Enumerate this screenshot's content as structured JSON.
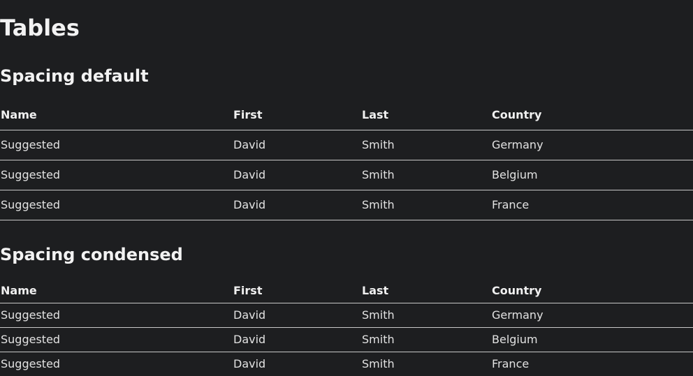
{
  "page": {
    "title": "Tables"
  },
  "sections": [
    {
      "title": "Spacing default",
      "columns": [
        "Name",
        "First",
        "Last",
        "Country"
      ],
      "rows": [
        [
          "Suggested",
          "David",
          "Smith",
          "Germany"
        ],
        [
          "Suggested",
          "David",
          "Smith",
          "Belgium"
        ],
        [
          "Suggested",
          "David",
          "Smith",
          "France"
        ]
      ]
    },
    {
      "title": "Spacing condensed",
      "columns": [
        "Name",
        "First",
        "Last",
        "Country"
      ],
      "rows": [
        [
          "Suggested",
          "David",
          "Smith",
          "Germany"
        ],
        [
          "Suggested",
          "David",
          "Smith",
          "Belgium"
        ],
        [
          "Suggested",
          "David",
          "Smith",
          "France"
        ]
      ]
    }
  ]
}
